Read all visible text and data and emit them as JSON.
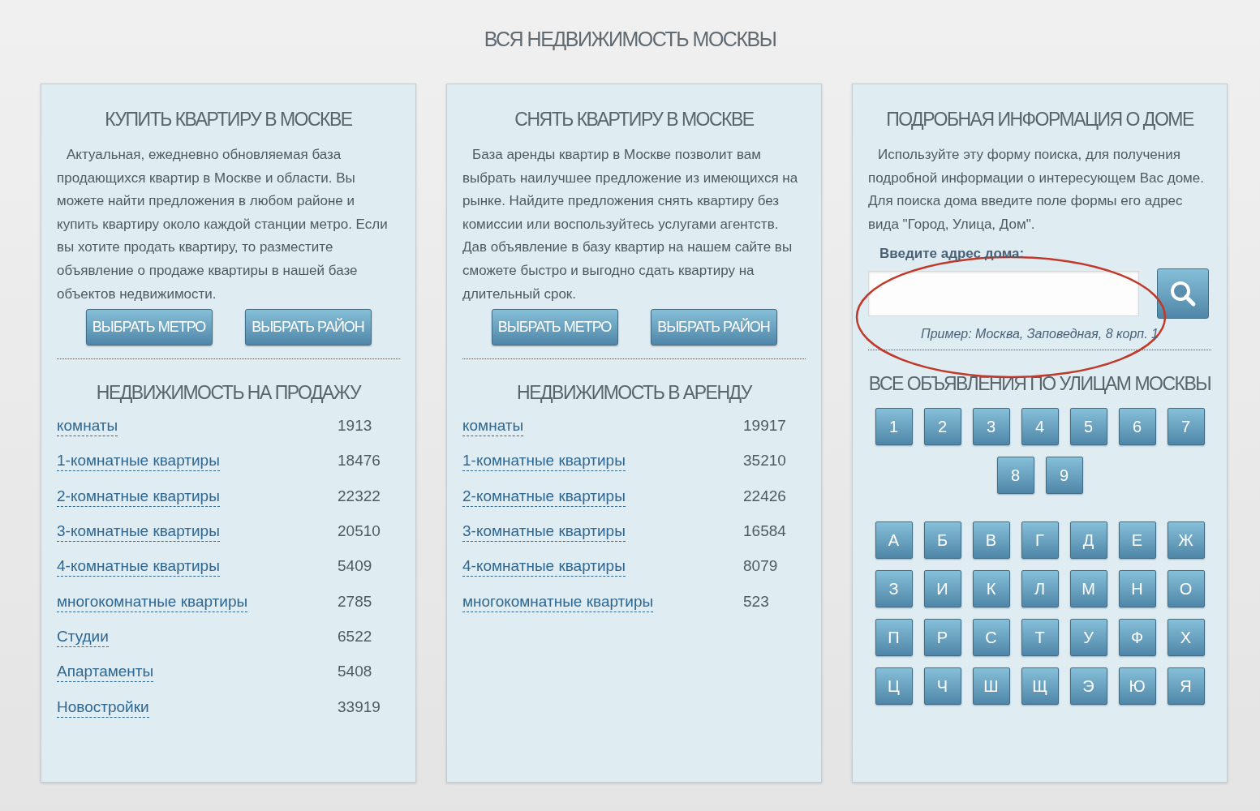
{
  "page_title": "ВСЯ НЕДВИЖИМОСТЬ МОСКВЫ",
  "panels": [
    {
      "kind": "listing",
      "title": "КУПИТЬ КВАРТИРУ В МОСКВЕ",
      "text": "Актуальная, ежедневно обновляемая база продающихся квартир в Москве и области. Вы можете найти предложения в любом районе и купить квартиру около каждой станции метро. Если вы хотите продать квартиру, то разместите объявление о продаже квартиры в нашей базе объектов недвижимости.",
      "buttons": [
        "ВЫБРАТЬ МЕТРО",
        "ВЫБРАТЬ РАЙОН"
      ],
      "section_title": "НЕДВИЖИМОСТЬ НА ПРОДАЖУ",
      "items": [
        {
          "label": "комнаты",
          "count": "1913"
        },
        {
          "label": "1-комнатные квартиры",
          "count": "18476"
        },
        {
          "label": "2-комнатные квартиры",
          "count": "22322"
        },
        {
          "label": "3-комнатные квартиры",
          "count": "20510"
        },
        {
          "label": "4-комнатные квартиры",
          "count": "5409"
        },
        {
          "label": "многокомнатные квартиры",
          "count": "2785"
        },
        {
          "label": "Студии",
          "count": "6522"
        },
        {
          "label": "Апартаменты",
          "count": "5408"
        },
        {
          "label": "Новостройки",
          "count": "33919"
        }
      ]
    },
    {
      "kind": "listing",
      "title": "СНЯТЬ КВАРТИРУ В МОСКВЕ",
      "text": "База аренды квартир в Москве позволит вам выбрать наилучшее предложение из имеющихся на рынке. Найдите предложения снять квартиру без комиссии или воспользуйтесь услугами агентств. Дав объявление в базу квартир на нашем сайте вы сможете быстро и выгодно сдать квартиру на длительный срок.",
      "buttons": [
        "ВЫБРАТЬ МЕТРО",
        "ВЫБРАТЬ РАЙОН"
      ],
      "section_title": "НЕДВИЖИМОСТЬ В АРЕНДУ",
      "items": [
        {
          "label": "комнаты",
          "count": "19917"
        },
        {
          "label": "1-комнатные квартиры",
          "count": "35210"
        },
        {
          "label": "2-комнатные квартиры",
          "count": "22426"
        },
        {
          "label": "3-комнатные квартиры",
          "count": "16584"
        },
        {
          "label": "4-комнатные квартиры",
          "count": "8079"
        },
        {
          "label": "многокомнатные квартиры",
          "count": "523"
        }
      ]
    },
    {
      "kind": "search",
      "title": "ПОДРОБНАЯ ИНФОРМАЦИЯ О ДОМЕ",
      "text": "Используйте эту форму поиска, для получения подробной информации о интересующем Вас доме. Для поиска дома введите поле формы его адрес вида \"Город, Улица, Дом\".",
      "field_label": "Введите адрес дома:",
      "hint": "Пример: Москва, Заповедная, 8 корп. 1",
      "highlight": {
        "kind": "ellipse"
      },
      "section_title": "ВСЕ ОБЪЯВЛЕНИЯ ПО УЛИЦАМ МОСКВЫ",
      "digit_keys": [
        "1",
        "2",
        "3",
        "4",
        "5",
        "6",
        "7",
        "8",
        "9"
      ],
      "letter_keys": [
        "А",
        "Б",
        "В",
        "Г",
        "Д",
        "Е",
        "Ж",
        "З",
        "И",
        "К",
        "Л",
        "М",
        "Н",
        "О",
        "П",
        "Р",
        "С",
        "Т",
        "У",
        "Ф",
        "Х",
        "Ц",
        "Ч",
        "Ш",
        "Щ",
        "Э",
        "Ю",
        "Я"
      ]
    }
  ]
}
